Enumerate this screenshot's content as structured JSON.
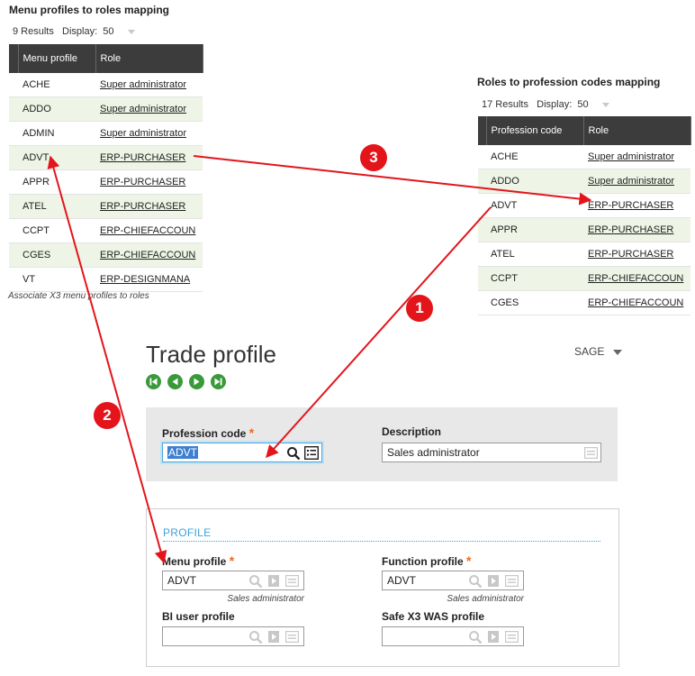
{
  "menu_profiles": {
    "title": "Menu profiles to roles mapping",
    "results": "9 Results",
    "display_label": "Display:",
    "display_value": "50",
    "columns": [
      "Menu profile",
      "Role"
    ],
    "rows": [
      [
        "ACHE",
        "Super administrator"
      ],
      [
        "ADDO",
        "Super administrator"
      ],
      [
        "ADMIN",
        "Super administrator"
      ],
      [
        "ADVT",
        "ERP-PURCHASER"
      ],
      [
        "APPR",
        "ERP-PURCHASER"
      ],
      [
        "ATEL",
        "ERP-PURCHASER"
      ],
      [
        "CCPT",
        "ERP-CHIEFACCOUN"
      ],
      [
        "CGES",
        "ERP-CHIEFACCOUN"
      ],
      [
        "VT",
        "ERP-DESIGNMANA"
      ]
    ],
    "caption": "Associate X3 menu profiles to roles"
  },
  "roles_profession": {
    "title": "Roles to profession codes mapping",
    "results": "17 Results",
    "display_label": "Display:",
    "display_value": "50",
    "columns": [
      "Profession code",
      "Role"
    ],
    "rows": [
      [
        "ACHE",
        "Super administrator"
      ],
      [
        "ADDO",
        "Super administrator"
      ],
      [
        "ADVT",
        "ERP-PURCHASER"
      ],
      [
        "APPR",
        "ERP-PURCHASER"
      ],
      [
        "ATEL",
        "ERP-PURCHASER"
      ],
      [
        "CCPT",
        "ERP-CHIEFACCOUN"
      ],
      [
        "CGES",
        "ERP-CHIEFACCOUN"
      ]
    ]
  },
  "trade_profile": {
    "title": "Trade profile",
    "user_menu": "SAGE",
    "nav_icons": [
      "first-icon",
      "previous-icon",
      "next-icon",
      "last-icon"
    ],
    "profession_code_label": "Profession code",
    "profession_code_value": "ADVT",
    "description_label": "Description",
    "description_value": "Sales administrator",
    "profile_section": "PROFILE",
    "menu_profile_label": "Menu profile",
    "menu_profile_value": "ADVT",
    "menu_profile_desc": "Sales administrator",
    "function_profile_label": "Function profile",
    "function_profile_value": "ADVT",
    "function_profile_desc": "Sales administrator",
    "bi_user_profile_label": "BI user profile",
    "bi_user_profile_value": "",
    "safe_x3_label": "Safe X3 WAS profile",
    "safe_x3_value": ""
  },
  "annotations": {
    "badges": [
      "1",
      "2",
      "3"
    ],
    "arrow_color": "#e3151b"
  },
  "colors": {
    "header_dark": "#3c3c3c",
    "row_alt": "#eef5e6",
    "accent_blue": "#3aa3d8",
    "required": "#ee6a1e",
    "nav_green": "#3a9a3a"
  }
}
